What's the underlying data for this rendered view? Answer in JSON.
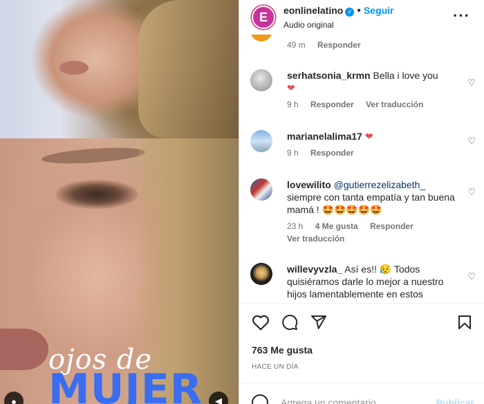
{
  "post": {
    "username": "eonlinelatino",
    "follow_label": "Seguir",
    "audio": "Audio original",
    "likes": "763 Me gusta",
    "time_ago": "HACE UN DÍA",
    "comment_placeholder": "Agrega un comentario...",
    "publish_label": "Publicar",
    "logo_letter": "E"
  },
  "video": {
    "overlay_line1": "ojos de",
    "overlay_line2": "MUJER"
  },
  "comments": [
    {
      "username": "",
      "text": "",
      "time": "49 m",
      "reply_label": "Responder"
    },
    {
      "username": "serhatsonia_krmn",
      "text": "Bella i love you",
      "time": "9 h",
      "reply_label": "Responder",
      "translate_label": "Ver traducción"
    },
    {
      "username": "marianelalima17",
      "text": "",
      "time": "9 h",
      "reply_label": "Responder"
    },
    {
      "username": "lovewilito",
      "mention": "@gutierrezelizabeth_",
      "text": "siempre con tanta empatía y tan buena mamá ! 🤩🤩🤩🤩🤩",
      "time": "23 h",
      "likes": "4 Me gusta",
      "reply_label": "Responder",
      "translate_label": "Ver traducción"
    },
    {
      "username": "willevyvzla_",
      "text": "Así es!! 😥 Todos quisiéramos darle lo mejor a nuestro hijos lamentablemente en estos"
    }
  ],
  "colors": {
    "accent": "#0095f6",
    "brand": "#c8329c",
    "like_red": "#ed4956"
  }
}
